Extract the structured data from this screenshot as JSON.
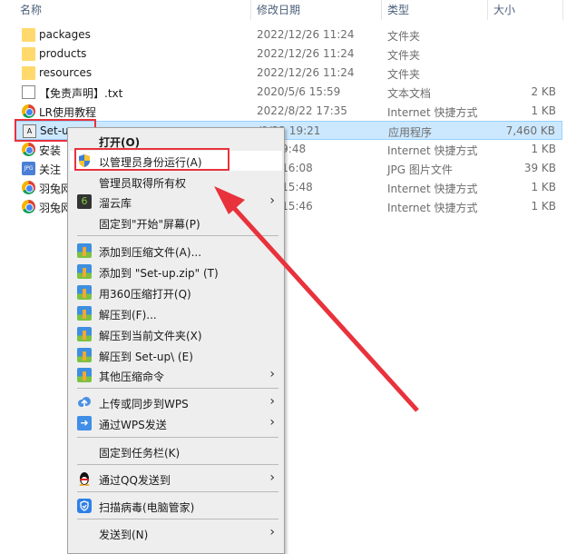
{
  "columns": {
    "name": "名称",
    "date": "修改日期",
    "type": "类型",
    "size": "大小"
  },
  "files": [
    {
      "name": "packages",
      "date": "2022/12/26 11:24",
      "type": "文件夹",
      "size": "",
      "icon": "folder-icon"
    },
    {
      "name": "products",
      "date": "2022/12/26 11:24",
      "type": "文件夹",
      "size": "",
      "icon": "folder-icon"
    },
    {
      "name": "resources",
      "date": "2022/12/26 11:24",
      "type": "文件夹",
      "size": "",
      "icon": "folder-icon"
    },
    {
      "name": "【免责声明】.txt",
      "date": "2020/5/6 15:59",
      "type": "文本文档",
      "size": "2 KB",
      "icon": "text-file-icon"
    },
    {
      "name": "LR使用教程",
      "date": "2022/8/22 17:35",
      "type": "Internet 快捷方式",
      "size": "1 KB",
      "icon": "chrome-shortcut-icon"
    },
    {
      "name": "Set-u",
      "date": "/9/22 19:21",
      "type": "应用程序",
      "size": "7,460 KB",
      "icon": "adobe-app-icon",
      "selected": true
    },
    {
      "name": "安装",
      "date": "/5/7 9:48",
      "type": "Internet 快捷方式",
      "size": "1 KB",
      "icon": "chrome-shortcut-icon"
    },
    {
      "name": "关注",
      "date": "/5/6 16:08",
      "type": "JPG 图片文件",
      "size": "39 KB",
      "icon": "jpg-icon"
    },
    {
      "name": "羽兔网",
      "date": "/5/6 15:48",
      "type": "Internet 快捷方式",
      "size": "1 KB",
      "icon": "chrome-shortcut-icon"
    },
    {
      "name": "羽兔网",
      "date": "/5/6 15:46",
      "type": "Internet 快捷方式",
      "size": "1 KB",
      "icon": "chrome-shortcut-icon"
    }
  ],
  "menu": {
    "open": "打开(O)",
    "run_as_admin": "以管理员身份运行(A)",
    "take_ownership": "管理员取得所有权",
    "liuyunku": "溜云库",
    "pin_start": "固定到\"开始\"屏幕(P)",
    "add_archive": "添加到压缩文件(A)...",
    "add_zip": "添加到 \"Set-up.zip\" (T)",
    "open_360": "用360压缩打开(Q)",
    "extract_to": "解压到(F)...",
    "extract_here": "解压到当前文件夹(X)",
    "extract_folder": "解压到 Set-up\\ (E)",
    "other_zip": "其他压缩命令",
    "upload_wps": "上传或同步到WPS",
    "send_wps": "通过WPS发送",
    "pin_taskbar": "固定到任务栏(K)",
    "send_qq": "通过QQ发送到",
    "scan_virus": "扫描病毒(电脑管家)",
    "send_to": "发送到(N)"
  },
  "colors": {
    "annotation": "#e8323c",
    "selection": "#cce8ff"
  }
}
